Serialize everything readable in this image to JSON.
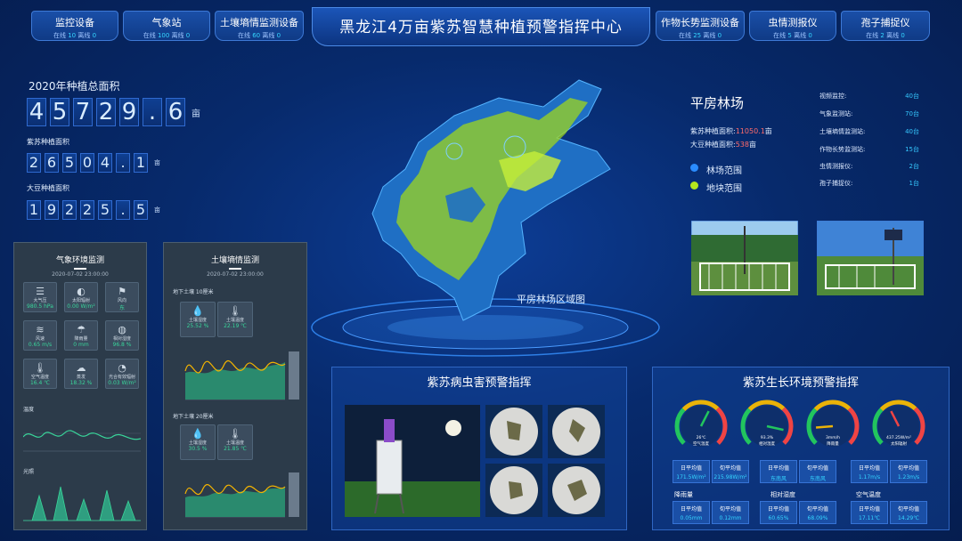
{
  "header": {
    "title": "黑龙江4万亩紫苏智慧种植预警指挥中心",
    "tabs": [
      {
        "name": "监控设备",
        "online_label": "在线",
        "online": "10",
        "offline_label": "离线",
        "offline": "0"
      },
      {
        "name": "气象站",
        "online_label": "在线",
        "online": "100",
        "offline_label": "离线",
        "offline": "0"
      },
      {
        "name": "土壤墒情监测设备",
        "online_label": "在线",
        "online": "60",
        "offline_label": "离线",
        "offline": "0"
      },
      {
        "name": "作物长势监测设备",
        "online_label": "在线",
        "online": "25",
        "offline_label": "离线",
        "offline": "0"
      },
      {
        "name": "虫情测报仪",
        "online_label": "在线",
        "online": "5",
        "offline_label": "离线",
        "offline": "0"
      },
      {
        "name": "孢子捕捉仪",
        "online_label": "在线",
        "online": "2",
        "offline_label": "离线",
        "offline": "0"
      }
    ]
  },
  "stats": {
    "total_label": "2020年种植总面积",
    "total_digits": [
      "4",
      "5",
      "7",
      "2",
      "9",
      ".",
      "6"
    ],
    "total_unit": "亩",
    "perilla_label": "紫苏种植面积",
    "perilla_digits": [
      "2",
      "6",
      "5",
      "0",
      "4",
      ".",
      "1"
    ],
    "perilla_unit": "亩",
    "soy_label": "大豆种植面积",
    "soy_digits": [
      "1",
      "9",
      "2",
      "2",
      "5",
      ".",
      "5"
    ],
    "soy_unit": "亩"
  },
  "weather": {
    "title": "气象环境监测",
    "date": "2020-07-02 23:00:00",
    "cards": [
      {
        "icon": "☰",
        "label": "大气压",
        "value": "980.5 hPa"
      },
      {
        "icon": "◐",
        "label": "太阳辐射",
        "value": "0.00 W/m²"
      },
      {
        "icon": "⚑",
        "label": "风向",
        "value": "东"
      },
      {
        "icon": "≋",
        "label": "风速",
        "value": "0.65 m/s"
      },
      {
        "icon": "☂",
        "label": "降雨量",
        "value": "0 mm"
      },
      {
        "icon": "◍",
        "label": "相对湿度",
        "value": "96.8 %"
      },
      {
        "icon": "🌡",
        "label": "空气温度",
        "value": "16.4 ℃"
      },
      {
        "icon": "☁",
        "label": "蒸发",
        "value": "18.32 %"
      },
      {
        "icon": "◔",
        "label": "光合有效辐射",
        "value": "0.03 W/m²"
      }
    ],
    "temp_label": "温度",
    "light_label": "光照"
  },
  "soil": {
    "title": "土壤墒情监测",
    "date": "2020-07-02 23:00:00",
    "depth1": "地下土壤 10厘米",
    "d1_moist_label": "土壤湿度",
    "d1_moist": "25.52 %",
    "d1_temp_label": "土壤温度",
    "d1_temp": "22.19 ℃",
    "depth2": "地下土壤 20厘米",
    "d2_moist_label": "土壤湿度",
    "d2_moist": "30.5 %",
    "d2_temp_label": "土壤温度",
    "d2_temp": "21.85 ℃"
  },
  "map": {
    "caption": "平房林场区域图"
  },
  "farm": {
    "title": "平房林场",
    "perilla_label": "紫苏种植面积:",
    "perilla_value": "11050.1",
    "perilla_unit": "亩",
    "soy_label": "大豆种植面积:",
    "soy_value": "538",
    "soy_unit": "亩",
    "legend_forest": "林场范围",
    "legend_plot": "地块范围",
    "forest_color": "#2a8cff",
    "plot_color": "#b5e61d",
    "devices": [
      {
        "label": "视频监控:",
        "value": "40台"
      },
      {
        "label": "气象监测站:",
        "value": "70台"
      },
      {
        "label": "土壤墒情监测站:",
        "value": "40台"
      },
      {
        "label": "作物长势监测站:",
        "value": "15台"
      },
      {
        "label": "虫情测报仪:",
        "value": "2台"
      },
      {
        "label": "孢子捕捉仪:",
        "value": "1台"
      }
    ]
  },
  "pest": {
    "title": "紫苏病虫害预警指挥"
  },
  "env": {
    "title": "紫苏生长环境预警指挥",
    "gauges": [
      {
        "center": "26℃",
        "label": "空气温度",
        "percent": 60,
        "needle": "#22c55e"
      },
      {
        "center": "93.3%",
        "label": "相对湿度",
        "percent": 88,
        "needle": "#22c55e"
      },
      {
        "center": "3mm/h",
        "label": "降雨量",
        "percent": 15,
        "needle": "#eab308"
      },
      {
        "center": "437.25W/m²",
        "label": "太阳辐射",
        "percent": 40,
        "needle": "#ef4444"
      }
    ],
    "row1": [
      {
        "a": "日平均值",
        "v": "171.5W/m²"
      },
      {
        "a": "旬平均值",
        "v": "215.98W/m²"
      },
      {
        "a": "日平均值",
        "v": "东南风"
      },
      {
        "a": "旬平均值",
        "v": "东南风"
      },
      {
        "a": "日平均值",
        "v": "1.17m/s"
      },
      {
        "a": "旬平均值",
        "v": "1.23m/s"
      }
    ],
    "g1": "降雨量",
    "g2": "相对湿度",
    "g3": "空气温度",
    "row2": [
      {
        "a": "日平均值",
        "v": "0.05mm"
      },
      {
        "a": "旬平均值",
        "v": "0.12mm"
      },
      {
        "a": "日平均值",
        "v": "60.65%"
      },
      {
        "a": "旬平均值",
        "v": "68.09%"
      },
      {
        "a": "日平均值",
        "v": "17.11℃"
      },
      {
        "a": "旬平均值",
        "v": "14.29℃"
      }
    ]
  }
}
